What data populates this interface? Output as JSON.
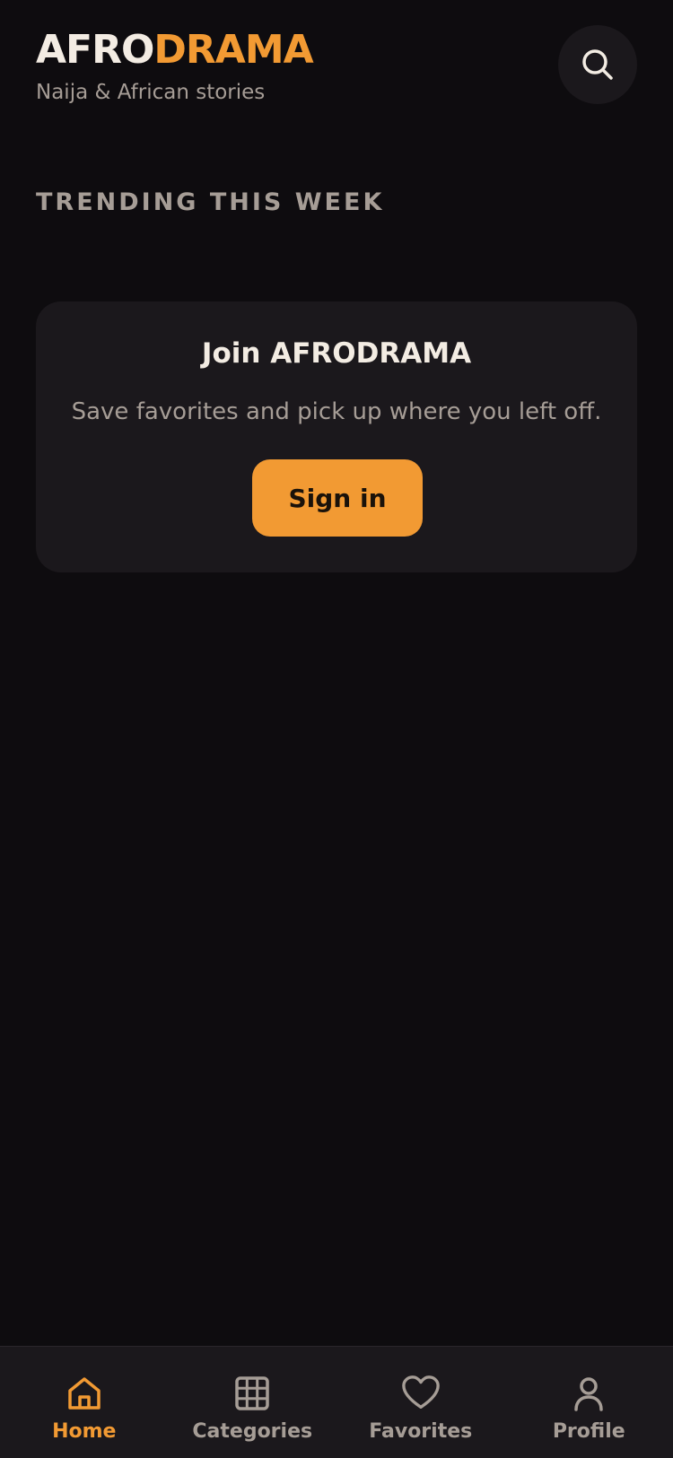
{
  "header": {
    "brand_part1": "AFRO",
    "brand_part2": "DRAMA",
    "tagline": "Naija & African stories",
    "search_icon": "search-icon"
  },
  "trending": {
    "title": "TRENDING THIS WEEK"
  },
  "join_card": {
    "title": "Join AFRODRAMA",
    "text": "Save favorites and pick up where you left off.",
    "button_label": "Sign in"
  },
  "bottom_nav": {
    "items": [
      {
        "label": "Home",
        "icon": "home-icon",
        "active": true
      },
      {
        "label": "Categories",
        "icon": "grid-icon",
        "active": false
      },
      {
        "label": "Favorites",
        "icon": "heart-icon",
        "active": false
      },
      {
        "label": "Profile",
        "icon": "user-icon",
        "active": false
      }
    ]
  },
  "colors": {
    "background": "#0e0c0f",
    "surface": "#1b181c",
    "accent": "#f29a33",
    "text_primary": "#f3ece3",
    "text_muted": "#a69d96"
  }
}
